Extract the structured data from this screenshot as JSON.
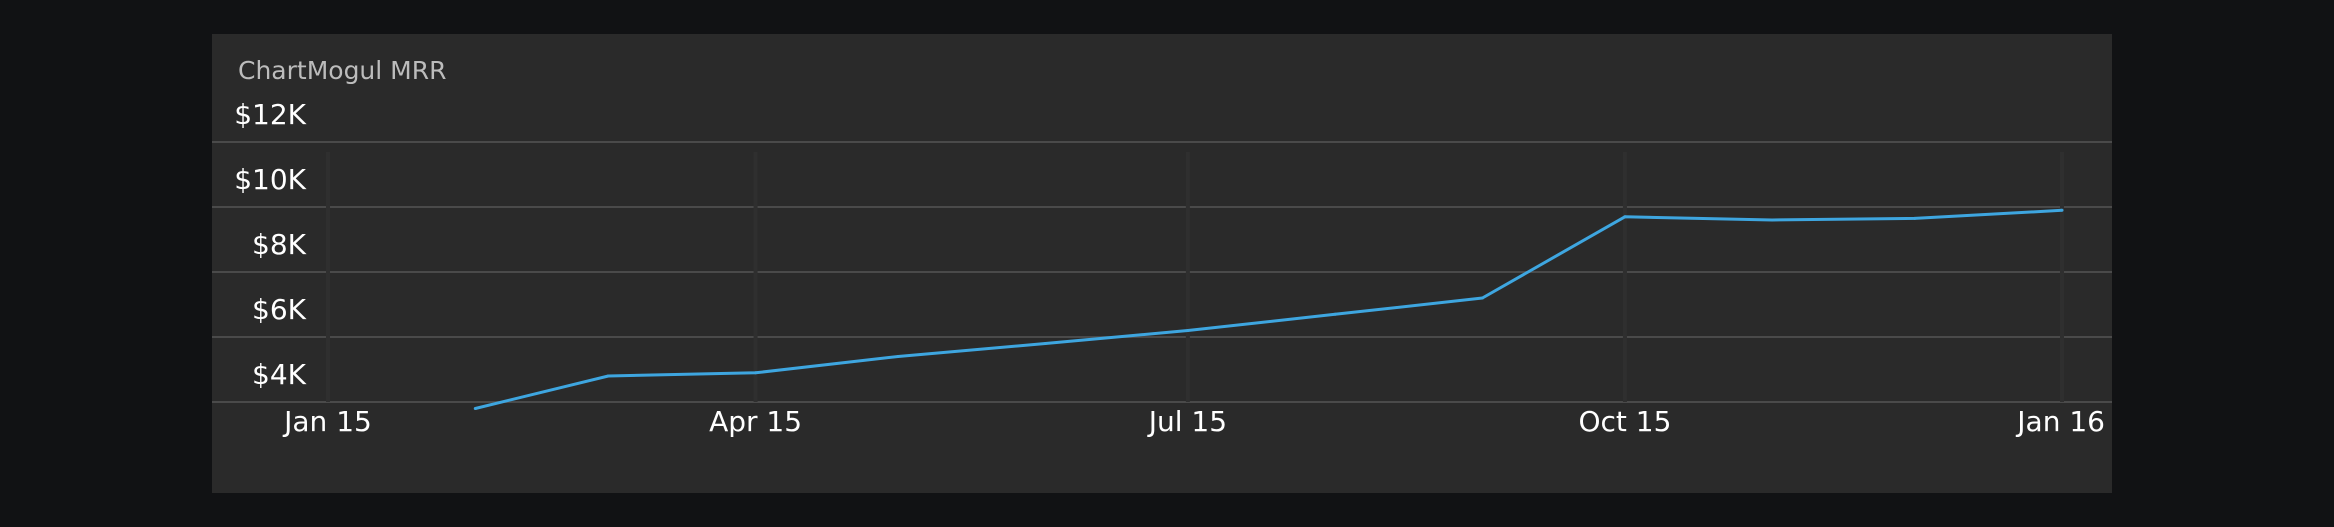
{
  "chart_data": {
    "type": "line",
    "title": "ChartMogul MRR",
    "xlabel": "",
    "ylabel": "",
    "y_ticks": [
      "$4K",
      "$6K",
      "$8K",
      "$10K",
      "$12K"
    ],
    "y_tick_values": [
      4000,
      6000,
      8000,
      10000,
      12000
    ],
    "ylim": [
      3000,
      13000
    ],
    "x_ticks": [
      "Jan 15",
      "Apr 15",
      "Jul 15",
      "Oct 15",
      "Jan 16"
    ],
    "x_tick_values": [
      "2015-01-01",
      "2015-04-01",
      "2015-07-01",
      "2015-10-01",
      "2016-01-01"
    ],
    "xlim": [
      "2015-01-01",
      "2016-01-01"
    ],
    "grid": true,
    "legend": "none",
    "series": [
      {
        "color": "#3ea6e0",
        "x": [
          "2015-02-01",
          "2015-03-01",
          "2015-04-01",
          "2015-05-01",
          "2015-06-01",
          "2015-07-01",
          "2015-08-01",
          "2015-09-01",
          "2015-10-01",
          "2015-11-01",
          "2015-12-01",
          "2016-01-01"
        ],
        "y": [
          3800,
          4800,
          4900,
          5400,
          5800,
          6200,
          6700,
          7200,
          9700,
          9600,
          9650,
          9900
        ]
      }
    ]
  }
}
